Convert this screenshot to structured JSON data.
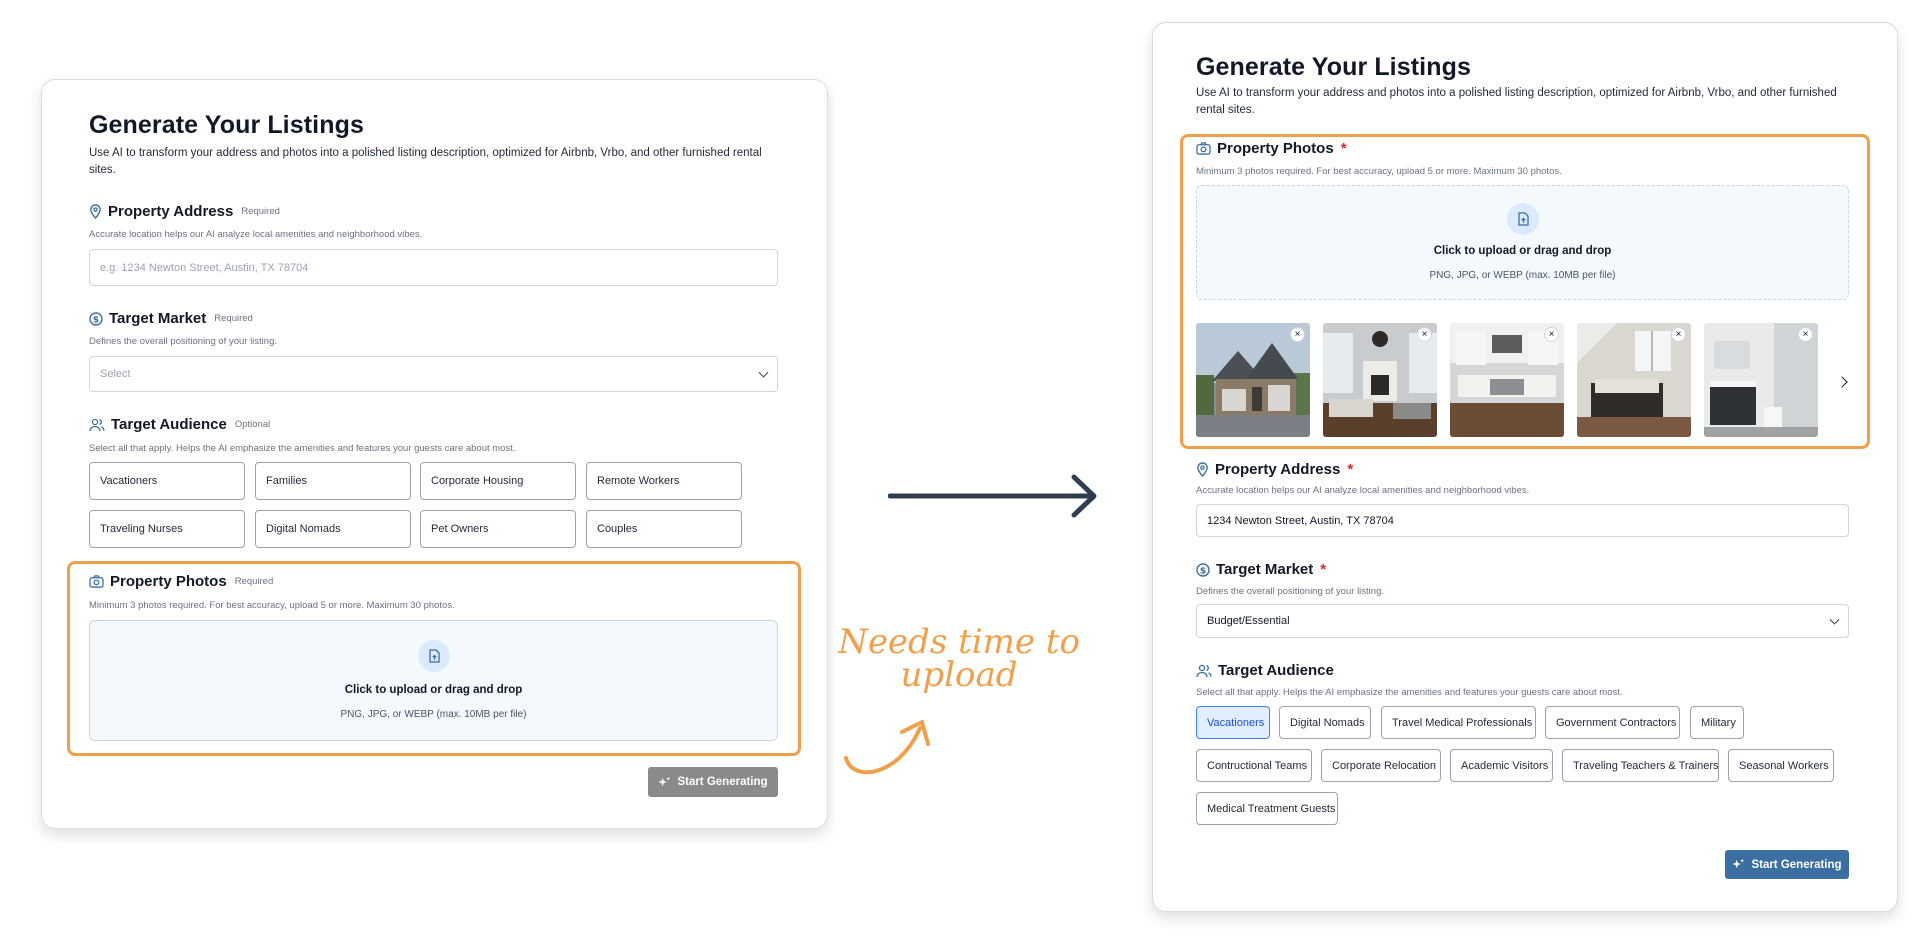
{
  "left": {
    "title": "Generate Your Listings",
    "description": "Use AI to transform your address and photos into a polished listing description, optimized for Airbnb, Vrbo, and other furnished rental sites.",
    "address": {
      "label": "Property Address",
      "tag": "Required",
      "hint": "Accurate location helps our AI analyze local amenities and neighborhood vibes.",
      "placeholder": "e.g. 1234 Newton Street, Austin, TX 78704"
    },
    "market": {
      "label": "Target Market",
      "tag": "Required",
      "hint": "Defines the overall positioning of your listing.",
      "value": "Select"
    },
    "audience": {
      "label": "Target Audience",
      "tag": "Optional",
      "hint": "Select all that apply. Helps the AI emphasize the amenities and features your guests care about most.",
      "chips": [
        "Vacationers",
        "Families",
        "Corporate Housing",
        "Remote Workers",
        "Traveling Nurses",
        "Digital Nomads",
        "Pet Owners",
        "Couples"
      ]
    },
    "photos": {
      "label": "Property Photos",
      "tag": "Required",
      "hint": "Minimum 3 photos required. For best accuracy, upload 5 or more. Maximum 30 photos.",
      "upload_title": "Click to upload or drag and drop",
      "upload_sub": "PNG, JPG, or WEBP (max. 10MB per file)"
    },
    "button": "Start Generating"
  },
  "right": {
    "title": "Generate Your Listings",
    "description": "Use AI to transform your address and photos into a polished listing description, optimized for Airbnb, Vrbo, and other furnished rental sites.",
    "photos": {
      "label": "Property Photos",
      "star": "*",
      "hint": "Minimum 3 photos required. For best accuracy, upload 5 or more. Maximum 30 photos.",
      "upload_title": "Click to upload or drag and drop",
      "upload_sub": "PNG, JPG, or WEBP (max. 10MB per file)",
      "remove_label": "×",
      "thumbnail_icons": [
        "house-exterior-photo",
        "living-room-photo",
        "kitchen-photo",
        "bedroom-photo",
        "bathroom-photo"
      ]
    },
    "address": {
      "label": "Property Address",
      "star": "*",
      "hint": "Accurate location helps our AI analyze local amenities and neighborhood vibes.",
      "value": "1234 Newton Street, Austin, TX 78704"
    },
    "market": {
      "label": "Target Market",
      "star": "*",
      "hint": "Defines the overall positioning of your listing.",
      "value": "Budget/Essential"
    },
    "audience": {
      "label": "Target Audience",
      "hint": "Select all that apply. Helps the AI emphasize the amenities and features your guests care about most.",
      "chips": [
        "Vacationers",
        "Digital Nomads",
        "Travel Medical Professionals",
        "Government Contractors",
        "Military",
        "Contructional Teams",
        "Corporate Relocation",
        "Academic Visitors",
        "Traveling Teachers & Trainers",
        "Seasonal Workers",
        "Medical Treatment Guests"
      ],
      "selected": "Vacationers"
    },
    "button": "Start Generating"
  },
  "annotation": {
    "note_line1": "Needs time to",
    "note_line2": "upload"
  },
  "colors": {
    "highlight": "#f0a04b",
    "primary_button": "#3c6fa1",
    "disabled_button": "#8a8a8a",
    "selected_chip_bg": "#e0efff",
    "arrow": "#2f3e4e"
  }
}
